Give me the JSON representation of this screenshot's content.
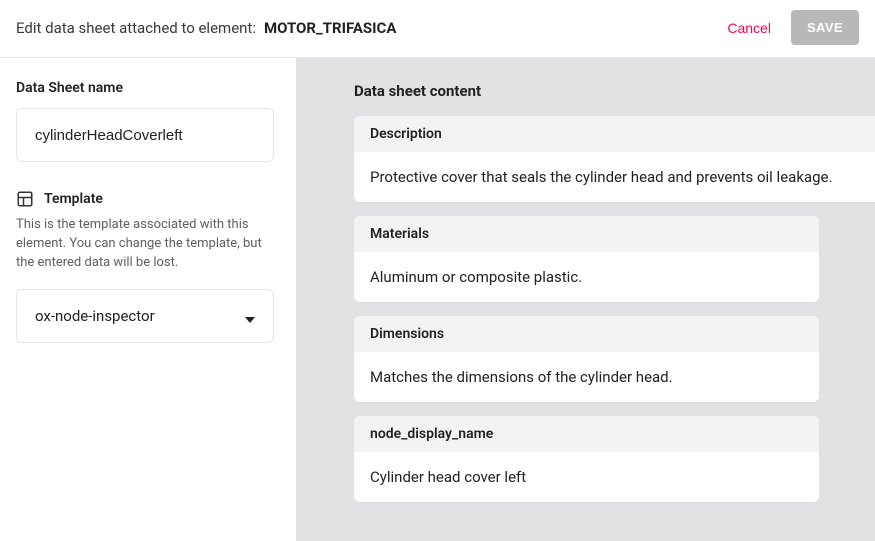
{
  "header": {
    "title": "Edit data sheet attached to element:",
    "element_name": "MOTOR_TRIFASICA",
    "cancel_label": "Cancel",
    "save_label": "SAVE"
  },
  "sidebar": {
    "name_label": "Data Sheet name",
    "name_value": "cylinderHeadCoverleft",
    "template_label": "Template",
    "template_desc": "This is the template associated with this element. You can change the template, but the entered data will be lost.",
    "template_value": "ox-node-inspector"
  },
  "content": {
    "title": "Data sheet content",
    "fields": [
      {
        "key": "Description",
        "value": "Protective cover that seals the cylinder head and prevents oil leakage.",
        "wide": true
      },
      {
        "key": "Materials",
        "value": "Aluminum or composite plastic.",
        "wide": false
      },
      {
        "key": "Dimensions",
        "value": "Matches the dimensions of the cylinder head.",
        "wide": false
      },
      {
        "key": "node_display_name",
        "value": "Cylinder head cover left",
        "wide": false
      }
    ]
  }
}
